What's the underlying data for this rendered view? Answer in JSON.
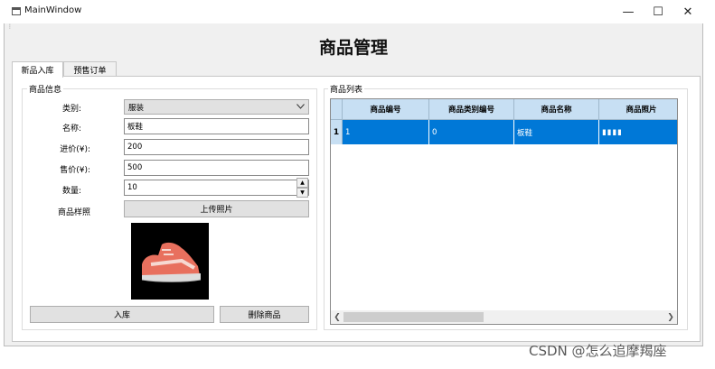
{
  "window": {
    "title": "MainWindow",
    "controls": {
      "minimize": "—",
      "maximize": "☐",
      "close": "✕"
    }
  },
  "app": {
    "title": "商品管理"
  },
  "tabs": [
    {
      "label": "新品入库",
      "active": true
    },
    {
      "label": "预售订单",
      "active": false
    }
  ],
  "form": {
    "group_title": "商品信息",
    "category_label": "类别:",
    "category_value": "服装",
    "name_label": "名称:",
    "name_value": "板鞋",
    "cost_label": "进价(¥):",
    "cost_value": "200",
    "price_label": "售价(¥):",
    "price_value": "500",
    "qty_label": "数量:",
    "qty_value": "10",
    "photo_label": "商品样照",
    "upload_button": "上传照片",
    "add_button": "入库",
    "delete_button": "删除商品",
    "preview_icon": "sneaker-image"
  },
  "list": {
    "group_title": "商品列表",
    "columns": [
      "商品编号",
      "商品类别编号",
      "商品名称",
      "商品照片"
    ],
    "rows": [
      {
        "index": "1",
        "cells": [
          "1",
          "0",
          "板鞋",
          "▮▮▮▮"
        ]
      }
    ]
  },
  "colors": {
    "selection": "#0078d7",
    "header": "#c7dff3",
    "sneaker": "#e8705e"
  },
  "watermark": "CSDN @怎么追摩羯座"
}
